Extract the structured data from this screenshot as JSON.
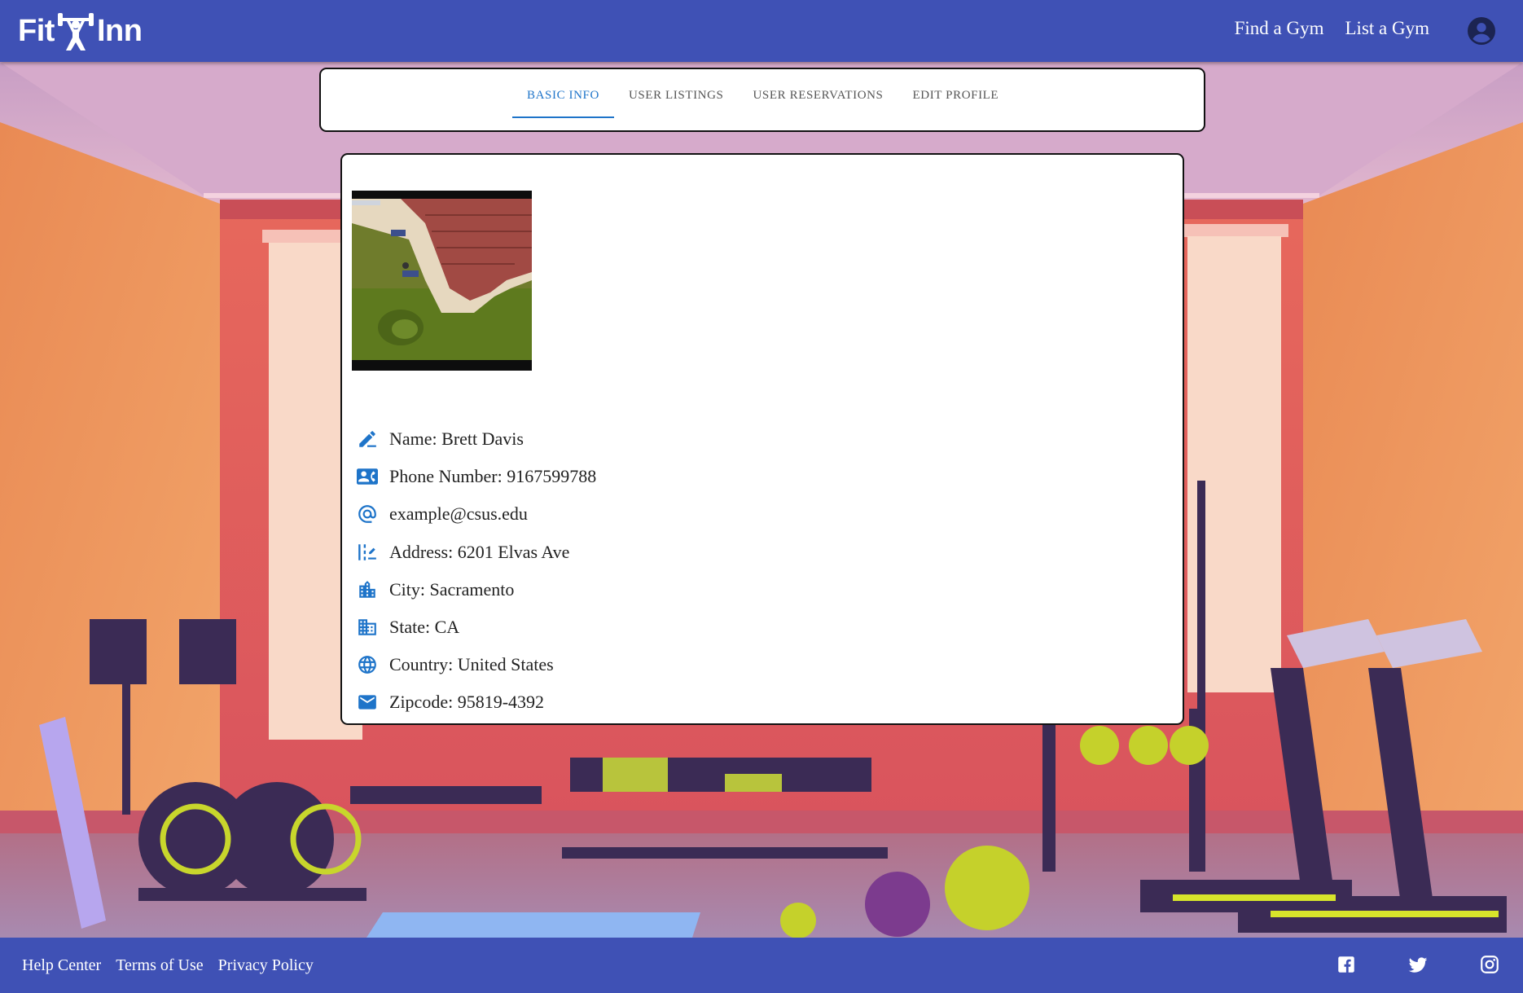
{
  "brand": {
    "logo_left": "Fit",
    "logo_right": "Inn"
  },
  "header": {
    "nav": [
      "Find a Gym",
      "List a Gym"
    ],
    "account_icon": "account-circle-icon"
  },
  "tabs": {
    "items": [
      "BASIC INFO",
      "USER LISTINGS",
      "USER RESERVATIONS",
      "EDIT PROFILE"
    ],
    "active": "BASIC INFO"
  },
  "profile": {
    "rows": [
      {
        "icon": "edit-pen-icon",
        "text": "Name: Brett Davis"
      },
      {
        "icon": "contact-card-icon",
        "text": "Phone Number: 9167599788"
      },
      {
        "icon": "at-sign-icon",
        "text": "example@csus.edu"
      },
      {
        "icon": "address-icon",
        "text": "Address: 6201 Elvas Ave"
      },
      {
        "icon": "city-buildings-icon",
        "text": "City: Sacramento"
      },
      {
        "icon": "state-building-icon",
        "text": "State: CA"
      },
      {
        "icon": "globe-icon",
        "text": "Country: United States"
      },
      {
        "icon": "mail-icon",
        "text": "Zipcode: 95819-4392"
      }
    ]
  },
  "footer": {
    "links": [
      "Help Center",
      "Terms of Use",
      "Privacy Policy"
    ],
    "social": [
      "facebook-icon",
      "twitter-icon",
      "instagram-icon"
    ]
  },
  "colors": {
    "brand_blue": "#3f51b5",
    "accent_blue": "#1e74c9"
  }
}
